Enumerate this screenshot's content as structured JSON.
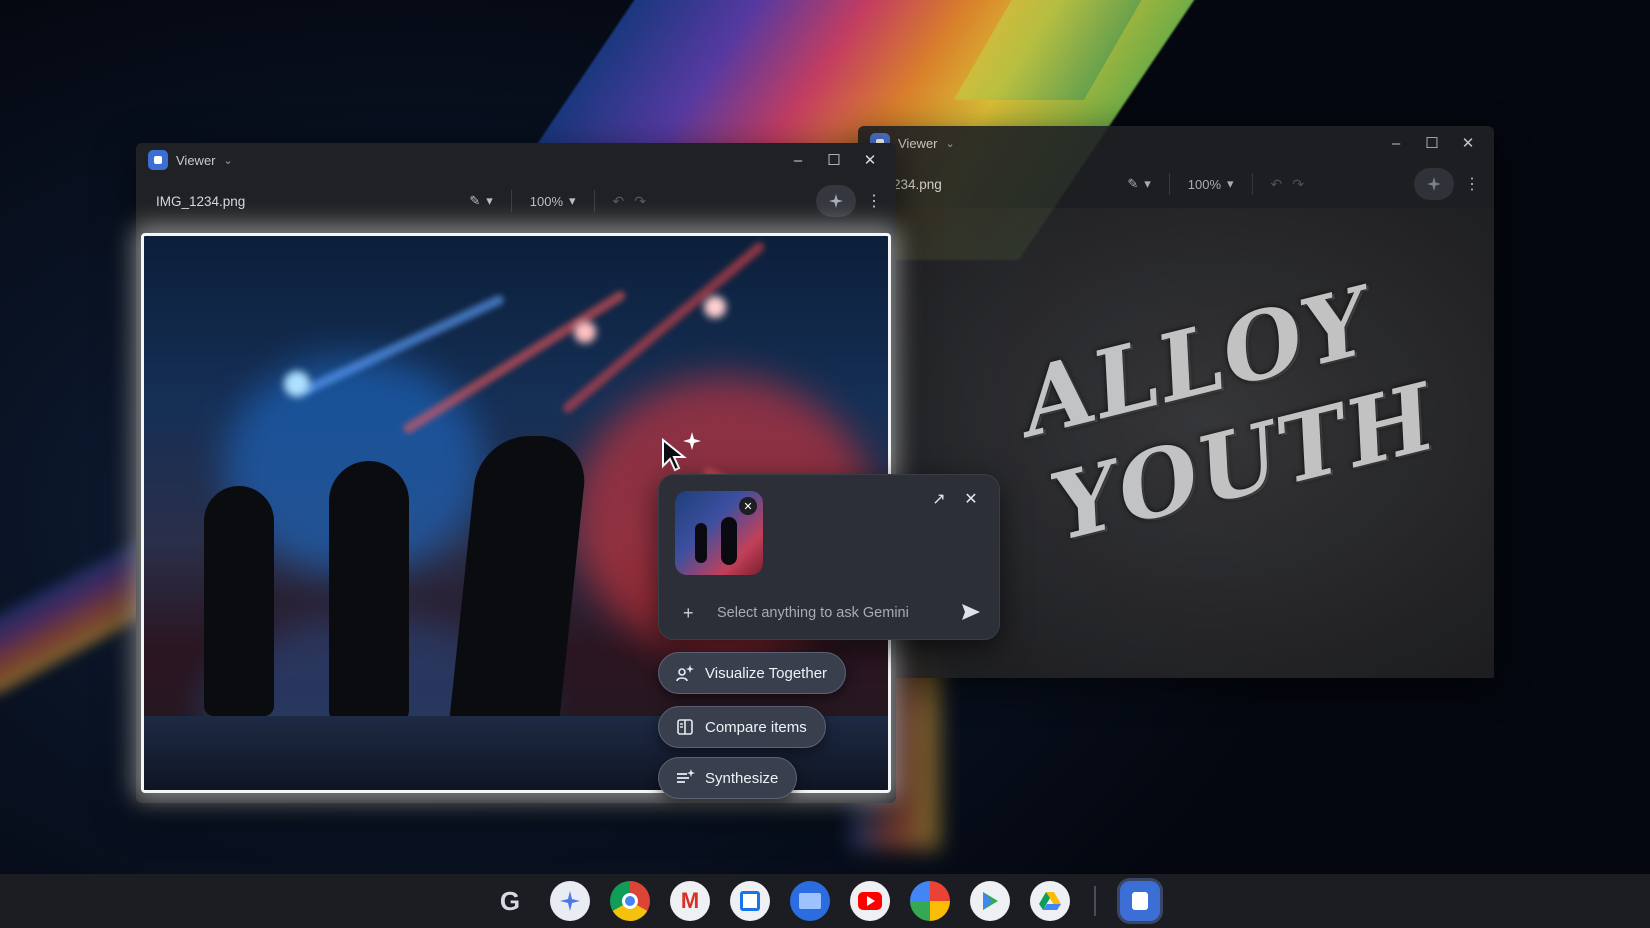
{
  "left_window": {
    "app_name": "Viewer",
    "filename": "IMG_1234.png",
    "zoom": "100%"
  },
  "right_window": {
    "app_name": "Viewer",
    "filename": "_1234.png",
    "zoom": "100%",
    "image_text_line1": "ALLOY",
    "image_text_line2": "YOUTH"
  },
  "gemini_panel": {
    "input_placeholder": "Select anything to ask Gemini"
  },
  "suggestions": [
    {
      "label": "Visualize Together",
      "icon": "sparkle-people-icon"
    },
    {
      "label": "Compare items",
      "icon": "compare-icon"
    },
    {
      "label": "Synthesize",
      "icon": "synthesize-icon"
    }
  ],
  "shelf": {
    "launcher": "G",
    "apps": [
      "gemini",
      "chrome",
      "gmail",
      "calendar",
      "files",
      "youtube",
      "photos",
      "play-store",
      "drive",
      "viewer"
    ]
  },
  "colors": {
    "accent": "#3b6fd6",
    "chip_bg": "#3a3f4e",
    "panel_bg": "#2c2f37"
  }
}
